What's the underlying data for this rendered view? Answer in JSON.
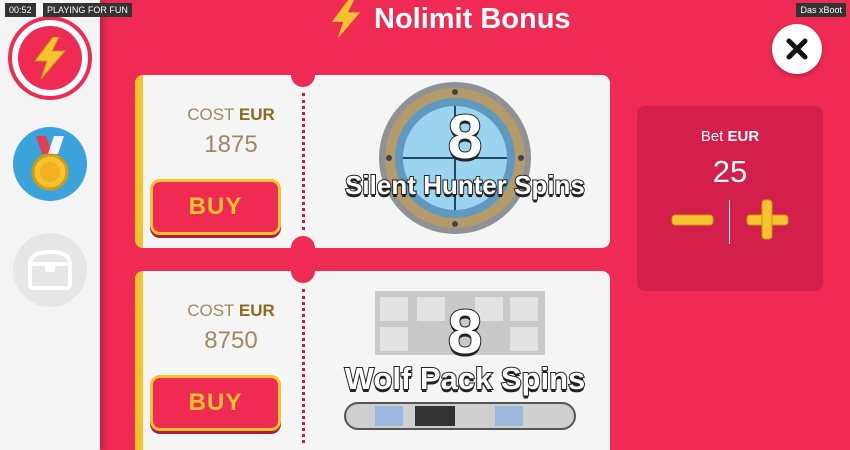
{
  "status_bar": {
    "time": "00:52",
    "mode": "PLAYING FOR FUN",
    "game_name": "Das xBoot"
  },
  "header": {
    "title": "Nolimit Bonus",
    "icon": "lightning-bolt-icon"
  },
  "sidebar": {
    "items": [
      {
        "name": "bonus-tab",
        "icon": "lightning-bolt-icon",
        "active": true
      },
      {
        "name": "achievements-tab",
        "icon": "medal-icon",
        "active": false
      },
      {
        "name": "treasure-chest-tab",
        "icon": "treasure-chest-icon",
        "active": false
      }
    ]
  },
  "offers": [
    {
      "cost_label": "COST",
      "currency": "EUR",
      "cost": "1875",
      "buy_label": "BUY",
      "spins": "8",
      "feature": "Silent Hunter Spins"
    },
    {
      "cost_label": "COST",
      "currency": "EUR",
      "cost": "8750",
      "buy_label": "BUY",
      "spins": "8",
      "feature": "Wolf Pack Spins"
    }
  ],
  "bet": {
    "label": "Bet",
    "currency": "EUR",
    "value": "25",
    "decrease_icon": "minus-icon",
    "increase_icon": "plus-icon"
  },
  "colors": {
    "background": "#ef2b53",
    "accent_gold": "#f6c22d",
    "ticket": "#f5f5f5",
    "bet_panel": "#d41f4b",
    "sidebar": "#f4f4f4"
  }
}
